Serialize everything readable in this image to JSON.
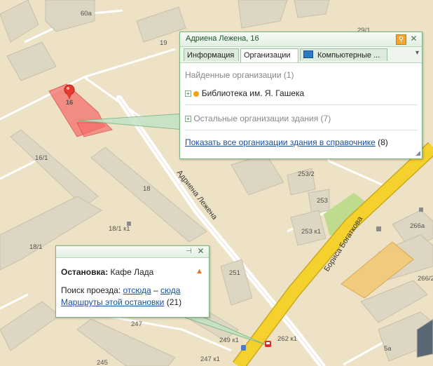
{
  "map": {
    "labels": {
      "b60a": "60а",
      "b29_1": "29/1",
      "b19": "19",
      "b16": "16",
      "b16_1": "16/1",
      "b18": "18",
      "b18_1_k1": "18/1 к1",
      "b18_1": "18/1",
      "b251": "251",
      "b253_2": "253/2",
      "b253": "253",
      "b253_k1": "253 к1",
      "b266a": "266а",
      "b266_2": "266/2",
      "b247": "247",
      "b245": "245",
      "b249_k1": "249 к1",
      "b262_k1": "262 к1",
      "b247_k1": "247 к1",
      "b5a": "5а"
    },
    "streets": {
      "lezhena": "Адриена Лежена",
      "bogatkova": "Бориса Богаткова"
    },
    "colors": {
      "ground": "#ede2c6",
      "building": "#ddd6c3",
      "road_main": "#f5d12e",
      "park": "#bfdc8e",
      "highlight": "#f46f6a"
    }
  },
  "building_card": {
    "title": "Адриена Лежена, 16",
    "tabs": [
      "Информация",
      "Организации",
      "Компьютерные ..."
    ],
    "active_tab": "Организации",
    "found_header": "Найденные организации (1)",
    "org_name": "Библиотека им. Я. Гашека",
    "other_orgs": "Остальные организации здания (7)",
    "show_all_link": "Показать все организации здания в справочнике",
    "show_all_count": "(8)"
  },
  "stop_card": {
    "label_bold": "Остановка:",
    "stop_name": "Кафе Лада",
    "route_prefix": "Поиск проезда:",
    "from_here": "отсюда",
    "dash": "–",
    "to_here": "сюда",
    "routes_link": "Маршруты этой остановки",
    "routes_count": "(21)"
  },
  "icons": {
    "pin": "map-pin-icon",
    "bus": "bus-stop-icon",
    "warning": "warning-icon"
  }
}
